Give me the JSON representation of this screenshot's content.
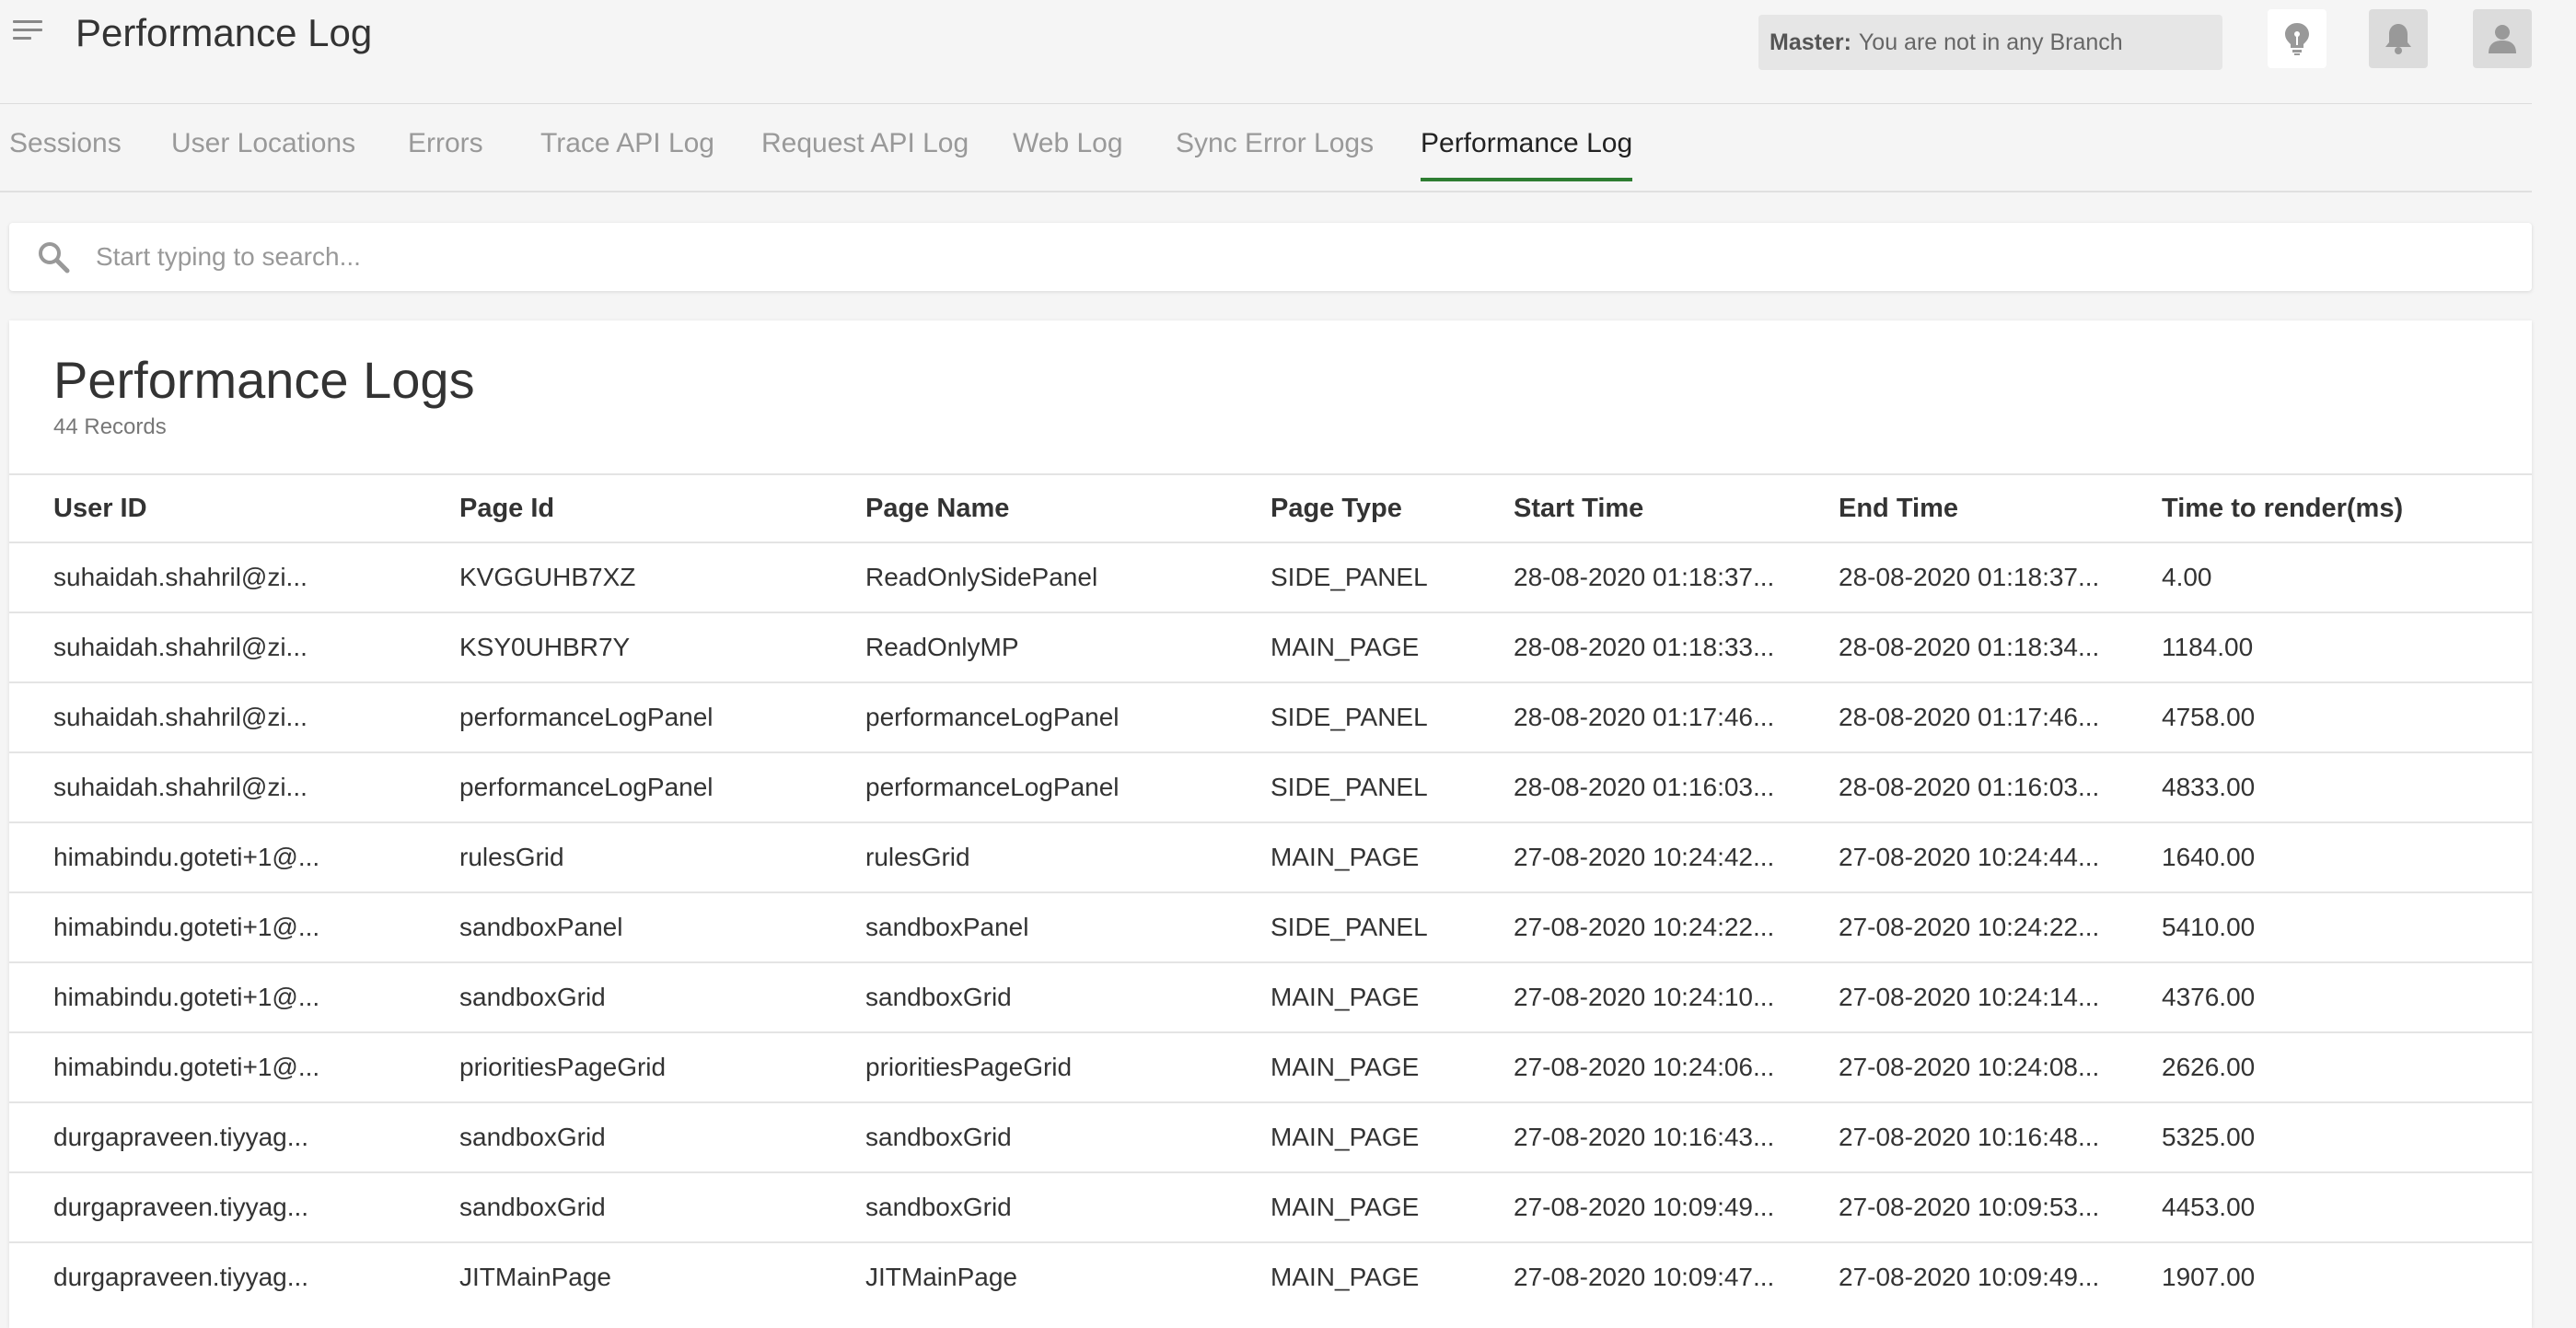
{
  "header": {
    "title": "Performance Log",
    "branch_label": "Master:",
    "branch_value": "You are not in any Branch"
  },
  "tabs": [
    {
      "label": "Sessions"
    },
    {
      "label": "User Locations"
    },
    {
      "label": "Errors"
    },
    {
      "label": "Trace API Log"
    },
    {
      "label": "Request API Log"
    },
    {
      "label": "Web Log"
    },
    {
      "label": "Sync Error Logs"
    },
    {
      "label": "Performance Log"
    }
  ],
  "active_tab": "Performance Log",
  "search": {
    "placeholder": "Start typing to search..."
  },
  "panel": {
    "title": "Performance Logs",
    "count": "44 Records"
  },
  "table": {
    "columns": [
      "User ID",
      "Page Id",
      "Page Name",
      "Page Type",
      "Start Time",
      "End Time",
      "Time to render(ms)"
    ],
    "rows": [
      [
        "suhaidah.shahril@zi...",
        "KVGGUHB7XZ",
        "ReadOnlySidePanel",
        "SIDE_PANEL",
        "28-08-2020 01:18:37...",
        "28-08-2020 01:18:37...",
        "4.00"
      ],
      [
        "suhaidah.shahril@zi...",
        "KSY0UHBR7Y",
        "ReadOnlyMP",
        "MAIN_PAGE",
        "28-08-2020 01:18:33...",
        "28-08-2020 01:18:34...",
        "1184.00"
      ],
      [
        "suhaidah.shahril@zi...",
        "performanceLogPanel",
        "performanceLogPanel",
        "SIDE_PANEL",
        "28-08-2020 01:17:46...",
        "28-08-2020 01:17:46...",
        "4758.00"
      ],
      [
        "suhaidah.shahril@zi...",
        "performanceLogPanel",
        "performanceLogPanel",
        "SIDE_PANEL",
        "28-08-2020 01:16:03...",
        "28-08-2020 01:16:03...",
        "4833.00"
      ],
      [
        "himabindu.goteti+1@...",
        "rulesGrid",
        "rulesGrid",
        "MAIN_PAGE",
        "27-08-2020 10:24:42...",
        "27-08-2020 10:24:44...",
        "1640.00"
      ],
      [
        "himabindu.goteti+1@...",
        "sandboxPanel",
        "sandboxPanel",
        "SIDE_PANEL",
        "27-08-2020 10:24:22...",
        "27-08-2020 10:24:22...",
        "5410.00"
      ],
      [
        "himabindu.goteti+1@...",
        "sandboxGrid",
        "sandboxGrid",
        "MAIN_PAGE",
        "27-08-2020 10:24:10...",
        "27-08-2020 10:24:14...",
        "4376.00"
      ],
      [
        "himabindu.goteti+1@...",
        "prioritiesPageGrid",
        "prioritiesPageGrid",
        "MAIN_PAGE",
        "27-08-2020 10:24:06...",
        "27-08-2020 10:24:08...",
        "2626.00"
      ],
      [
        "durgapraveen.tiyyag...",
        "sandboxGrid",
        "sandboxGrid",
        "MAIN_PAGE",
        "27-08-2020 10:16:43...",
        "27-08-2020 10:16:48...",
        "5325.00"
      ],
      [
        "durgapraveen.tiyyag...",
        "sandboxGrid",
        "sandboxGrid",
        "MAIN_PAGE",
        "27-08-2020 10:09:49...",
        "27-08-2020 10:09:53...",
        "4453.00"
      ],
      [
        "durgapraveen.tiyyag...",
        "JITMainPage",
        "JITMainPage",
        "MAIN_PAGE",
        "27-08-2020 10:09:47...",
        "27-08-2020 10:09:49...",
        "1907.00"
      ]
    ]
  },
  "icons": {
    "menu": "menu-icon",
    "bulb": "lightbulb-icon",
    "bell": "bell-icon",
    "user": "user-icon",
    "search": "search-icon"
  },
  "colors": {
    "active_tab_underline": "#2e7d32",
    "background": "#f5f5f5"
  }
}
